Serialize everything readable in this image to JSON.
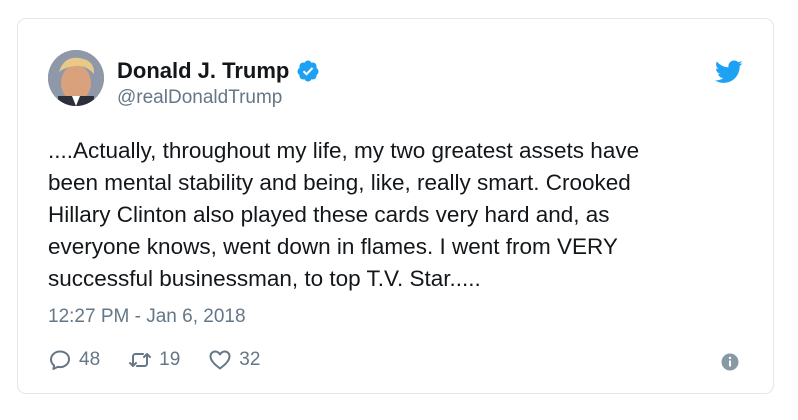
{
  "tweet": {
    "author_name": "Donald J. Trump",
    "author_handle": "@realDonaldTrump",
    "text_lines": [
      "....Actually, throughout my life, my two greatest assets have",
      "been mental stability and being, like, really smart. Crooked",
      "Hillary Clinton also played these cards very hard and, as",
      "everyone knows, went down in flames. I went from VERY",
      "successful businessman, to top T.V. Star....."
    ],
    "timestamp": "12:27 PM - Jan 6, 2018",
    "reply_count": "48",
    "retweet_count": "19",
    "like_count": "32"
  },
  "icons": {
    "verified": "verified-badge-icon",
    "brand": "twitter-bird-icon",
    "reply": "reply-icon",
    "retweet": "retweet-icon",
    "like": "heart-icon",
    "info": "info-icon"
  },
  "colors": {
    "twitter_blue": "#1da1f2",
    "secondary_text": "#657786",
    "border": "#e1e8ed"
  }
}
